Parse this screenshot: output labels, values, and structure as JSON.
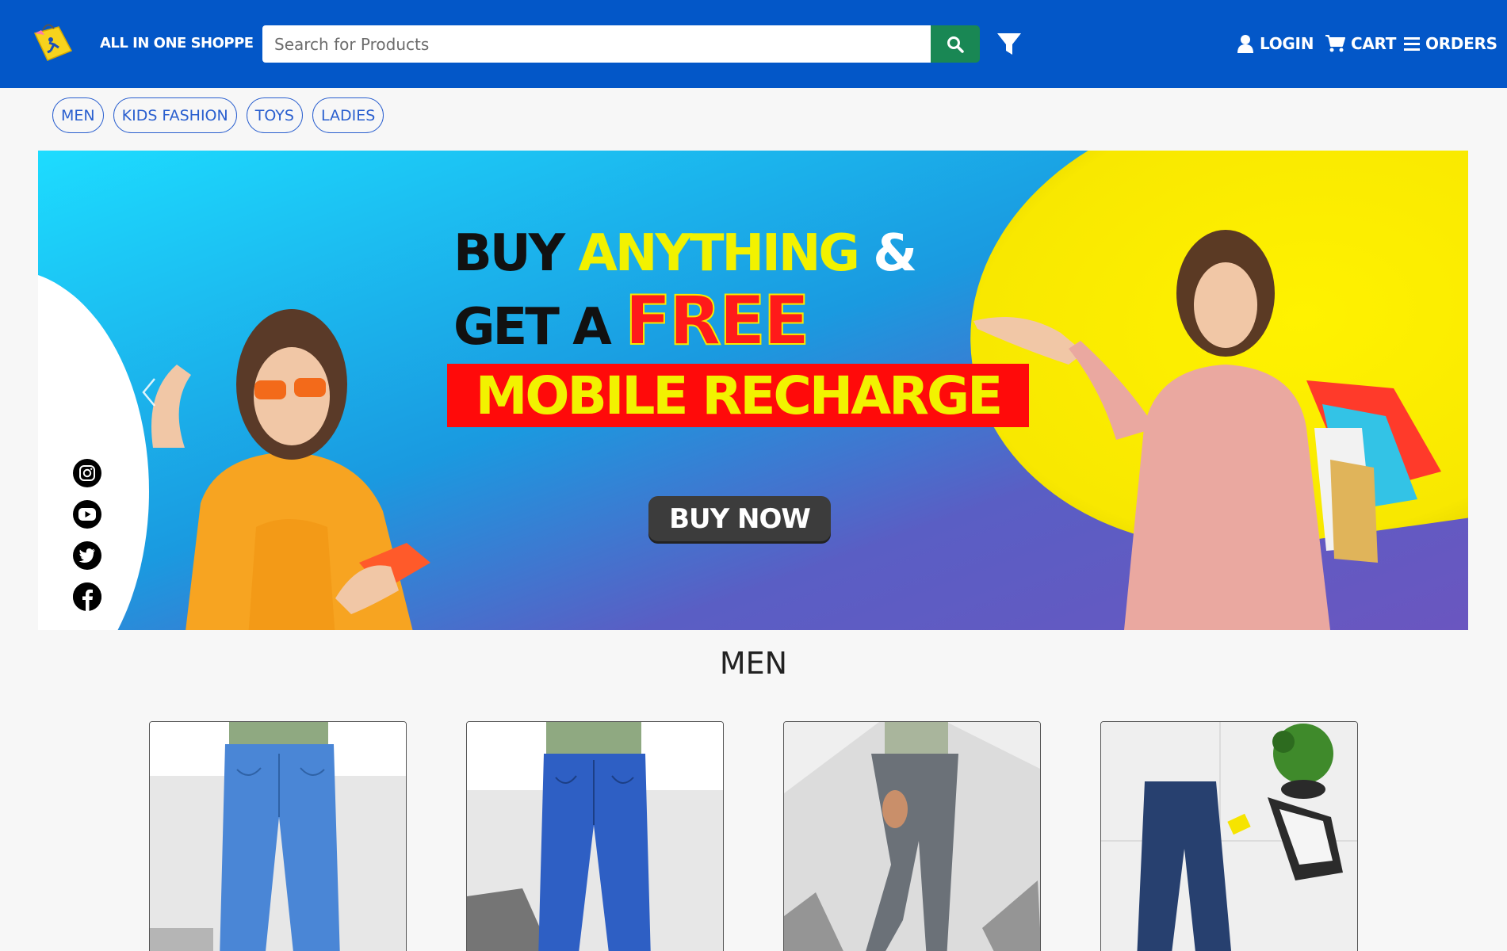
{
  "header": {
    "brand_name": "ALL IN ONE SHOPPE",
    "search": {
      "placeholder": "Search for Products",
      "value": ""
    },
    "nav": {
      "login_label": "LOGIN",
      "cart_label": "CART",
      "orders_label": "ORDERS"
    },
    "icons": [
      "logo-icon",
      "search-icon",
      "filter-icon",
      "user-icon",
      "cart-icon",
      "menu-icon"
    ]
  },
  "categories": [
    "MEN",
    "KIDS FASHION",
    "TOYS",
    "LADIES"
  ],
  "banner": {
    "line1_a": "BUY",
    "line1_b": "ANYTHING",
    "line1_c": "&",
    "line2_a": "GET A",
    "line2_b": "FREE",
    "line3": "MOBILE RECHARGE",
    "cta": "BUY NOW",
    "social_icons": [
      "instagram-icon",
      "youtube-icon",
      "twitter-icon",
      "facebook-icon"
    ]
  },
  "section": {
    "title": "MEN",
    "products": [
      {
        "image": "light-blue-jeans"
      },
      {
        "image": "blue-jeans"
      },
      {
        "image": "grey-jeans"
      },
      {
        "image": "dark-denim-flatlay"
      }
    ]
  },
  "colors": {
    "header_bg": "#0357c8",
    "search_button": "#198754",
    "pill_border": "#2a5fcf",
    "page_bg": "#f7f7f7"
  }
}
